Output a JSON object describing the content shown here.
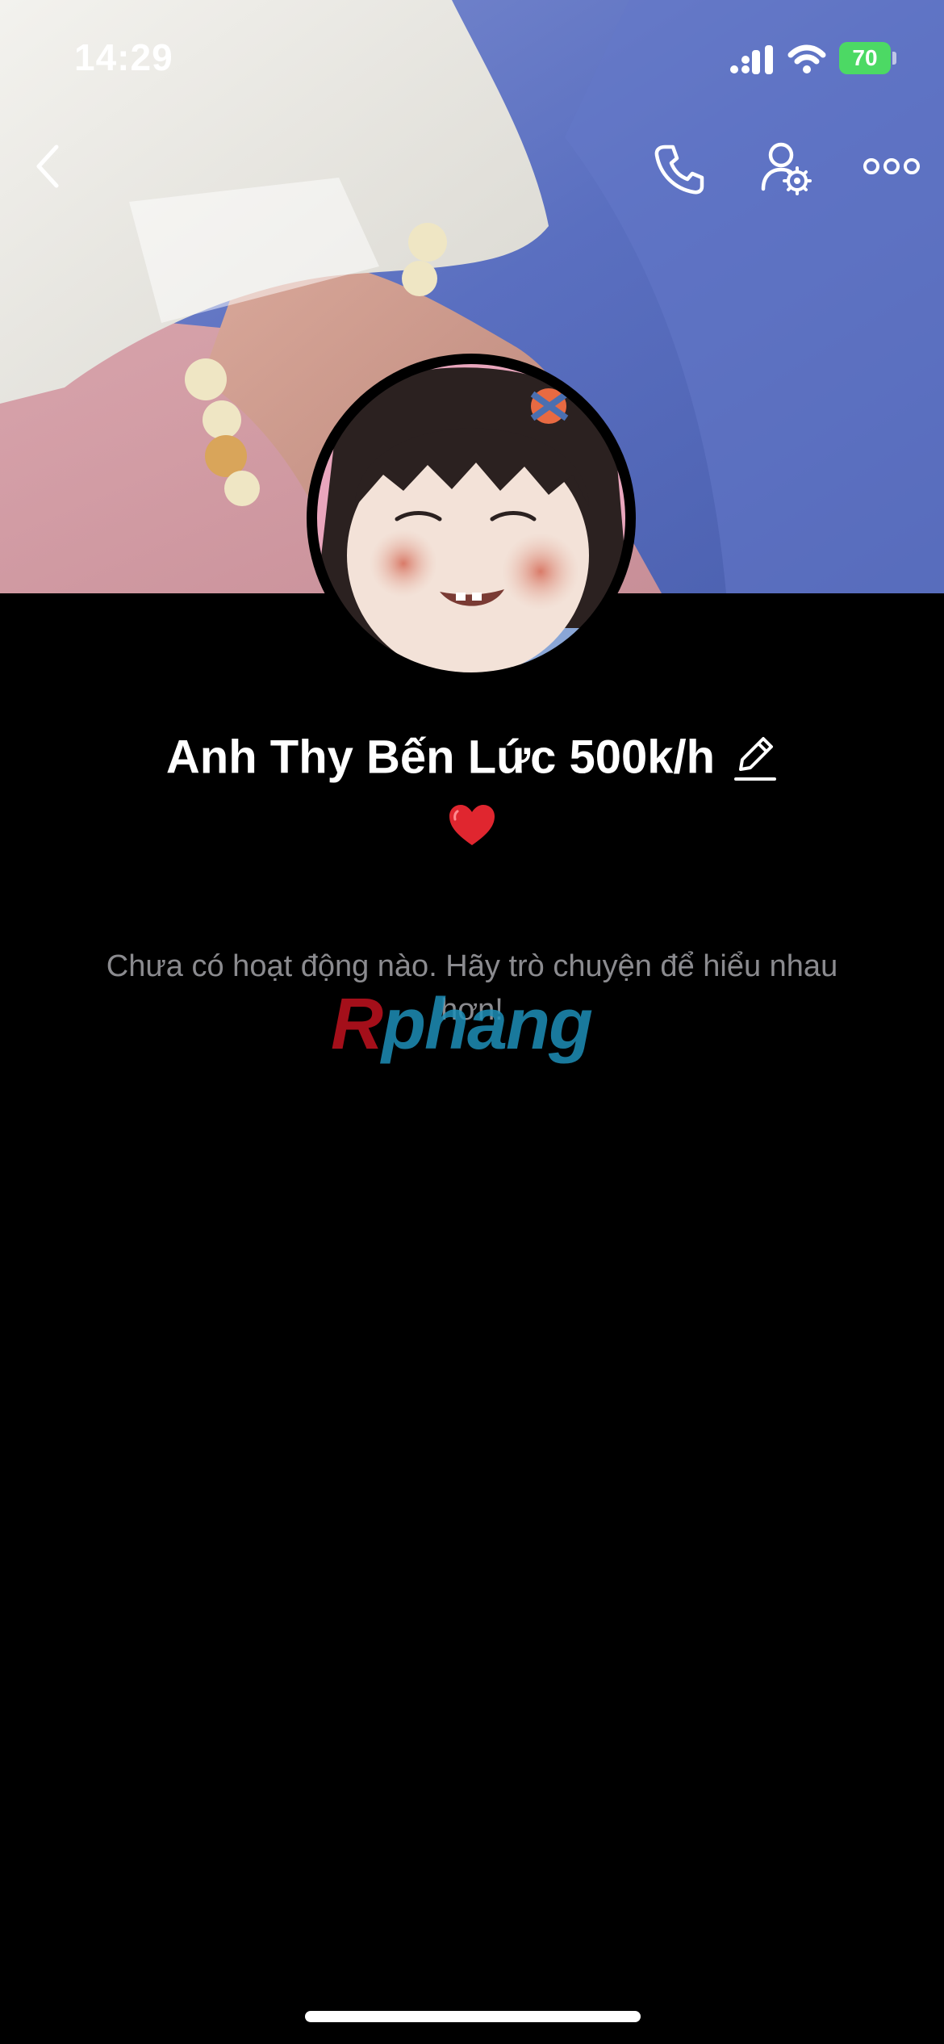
{
  "status_bar": {
    "time": "14:29",
    "battery_level": "70",
    "signal_icon": "cellular-signal-icon",
    "wifi_icon": "wifi-icon",
    "battery_icon": "battery-charging-icon"
  },
  "nav": {
    "back_icon": "chevron-left-icon",
    "call_icon": "phone-icon",
    "settings_icon": "user-settings-icon",
    "more_icon": "more-dots-icon"
  },
  "profile": {
    "name": "Anh Thy Bến Lức 500k/h",
    "status_emoji": "❤️",
    "edit_icon": "pencil-edit-icon"
  },
  "feed": {
    "empty_message": "Chưa có hoạt động nào. Hãy trò chuyện để hiểu nhau hơn!"
  },
  "watermark": {
    "part_a": "R",
    "part_b": "phang"
  },
  "colors": {
    "background": "#000000",
    "battery": "#4cd964",
    "muted_text": "#8b8b8f",
    "heart": "#e0262f"
  }
}
